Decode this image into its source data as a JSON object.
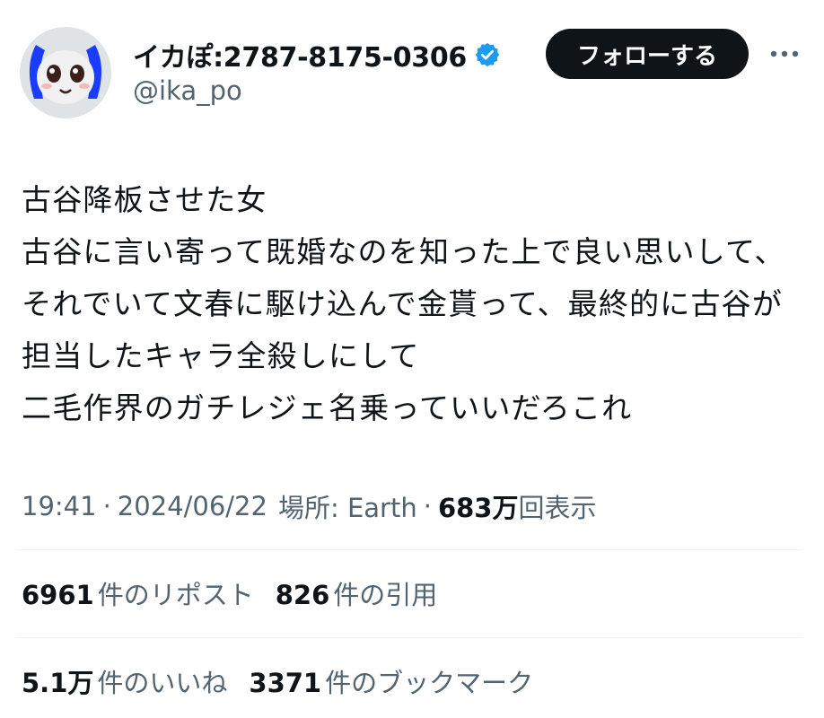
{
  "author": {
    "display_name": "イカぽ:2787-8175-0306",
    "handle": "@ika_po",
    "verified_icon": "verified-badge-icon",
    "verified_color": "#1d9bf0"
  },
  "actions": {
    "follow_label": "フォローする",
    "more_icon": "more-dots-icon"
  },
  "tweet": {
    "text": "古谷降板させた女\n古谷に言い寄って既婚なのを知った上で良い思いして、それでいて文春に駆け込んで金貰って、最終的に古谷が担当したキャラ全殺しにして\n二毛作界のガチレジェ名乗っていいだろこれ"
  },
  "meta": {
    "time": "19:41",
    "separator": "·",
    "date": "2024/06/22",
    "location": "場所: Earth",
    "views_count": "683万",
    "views_label": "回表示"
  },
  "stats": {
    "reposts_count": "6961",
    "reposts_label": "件のリポスト",
    "quotes_count": "826",
    "quotes_label": "件の引用",
    "likes_count": "5.1万",
    "likes_label": "件のいいね",
    "bookmarks_count": "3371",
    "bookmarks_label": "件のブックマーク"
  },
  "colors": {
    "text_primary": "#0f1419",
    "text_secondary": "#536471",
    "divider": "#eff3f4",
    "follow_button_bg": "#0f1419"
  }
}
